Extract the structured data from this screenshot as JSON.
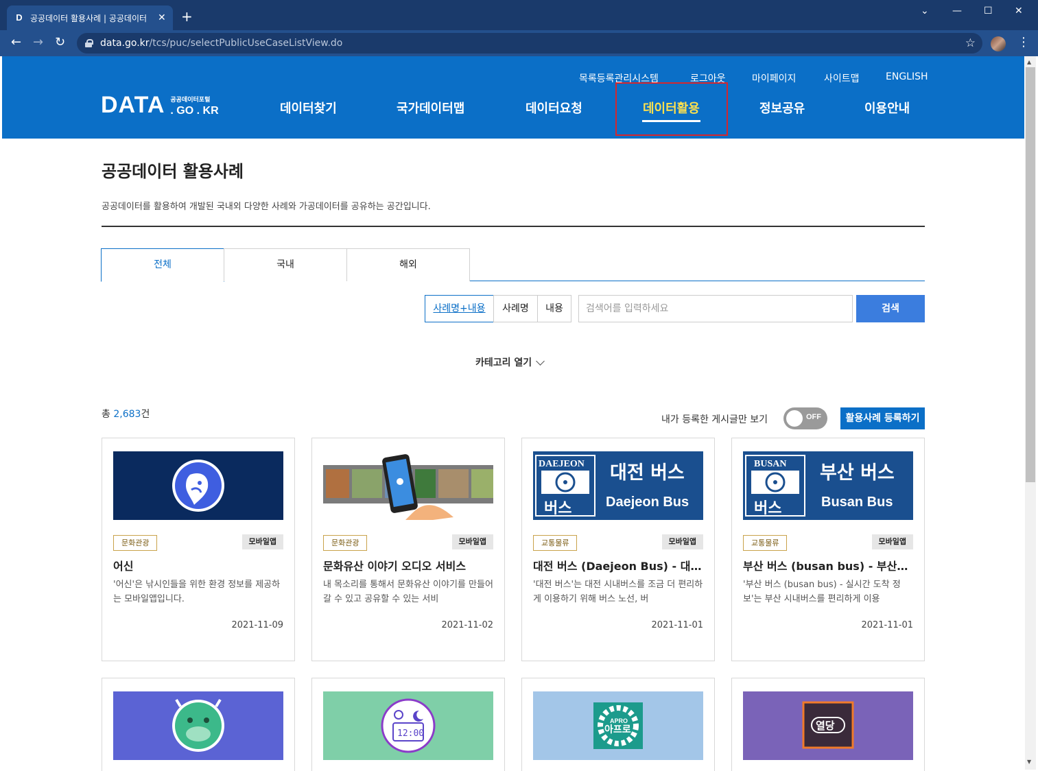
{
  "browser": {
    "tab_title": "공공데이터 활용사례 | 공공데이터",
    "url_host": "data.go.kr",
    "url_path": "/tcs/puc/selectPublicUseCaseListView.do"
  },
  "header": {
    "util_links": [
      "목록등록관리시스템",
      "로그아웃",
      "마이페이지",
      "사이트맵",
      "ENGLISH"
    ],
    "logo_main": "DATA",
    "logo_small": "공공데이터포털",
    "logo_domain": ". GO . KR",
    "gnb": [
      "데이터찾기",
      "국가데이터맵",
      "데이터요청",
      "데이터활용",
      "정보공유",
      "이용안내"
    ],
    "active_gnb": "데이터활용"
  },
  "page": {
    "title": "공공데이터 활용사례",
    "description": "공공데이터를 활용하여 개발된 국내외 다양한 사례와 가공데이터를 공유하는 공간입니다.",
    "tabs": [
      "전체",
      "국내",
      "해외"
    ],
    "active_tab": "전체"
  },
  "search": {
    "filters": [
      "사례명+내용",
      "사례명",
      "내용"
    ],
    "active_filter": "사례명+내용",
    "placeholder": "검색어를 입력하세요",
    "button": "검색"
  },
  "category_toggle": "카테고리 열기",
  "list_meta": {
    "total_prefix": "총 ",
    "total_count": "2,683",
    "total_suffix": "건",
    "mine_label": "내가 등록한 게시글만 보기",
    "toggle_state": "OFF",
    "register_button": "활용사례 등록하기"
  },
  "cards": [
    {
      "category": "문화관광",
      "type": "모바일앱",
      "title": "어신",
      "desc": "'어신'은 낚시인들을 위한 환경 정보를 제공하는 모바일앱입니다.",
      "date": "2021-11-09",
      "thumb_bg": "#0a2a5e",
      "thumb_icon": "fish-logo-icon"
    },
    {
      "category": "문화관광",
      "type": "모바일앱",
      "title": "문화유산 이야기 오디오 서비스",
      "desc": "내 목소리를 통해서 문화유산 이야기를 만들어갈 수 있고 공유할 수 있는 서비",
      "date": "2021-11-02",
      "thumb_bg": "#ffffff",
      "thumb_icon": "heritage-phone-icon"
    },
    {
      "category": "교통물류",
      "type": "모바일앱",
      "title": "대전 버스 (Daejeon Bus) - 대전광역시 버스 도착 정보",
      "desc": "'대전 버스'는 대전 시내버스를 조금 더 편리하게 이용하기 위해 버스 노선, 버",
      "date": "2021-11-01",
      "thumb_bg": "#1a4f8f",
      "thumb_icon": "daejeon-bus-logo",
      "thumb_en": "DAEJEON",
      "thumb_ko": "대전 버스",
      "thumb_sub": "Daejeon Bus",
      "thumb_small": "버스"
    },
    {
      "category": "교통물류",
      "type": "모바일앱",
      "title": "부산 버스 (busan bus) - 부산광역시 버스 도착 정보",
      "desc": "'부산 버스 (busan bus) - 실시간 도착 정보'는 부산 시내버스를 편리하게 이용",
      "date": "2021-11-01",
      "thumb_bg": "#1a4f8f",
      "thumb_icon": "busan-bus-logo",
      "thumb_en": "BUSAN",
      "thumb_ko": "부산 버스",
      "thumb_sub": "Busan Bus",
      "thumb_small": "버스"
    }
  ],
  "cards_row2": [
    {
      "thumb_bg": "#5b63d4",
      "thumb_icon": "cow-face-icon"
    },
    {
      "thumb_bg": "#7fcfa8",
      "thumb_icon": "clock-sun-moon-icon",
      "thumb_text": "12:00"
    },
    {
      "thumb_bg": "#a3c6e8",
      "thumb_icon": "apro-gear-icon",
      "thumb_text": "APRO",
      "thumb_text2": "아프로"
    },
    {
      "thumb_bg": "#7a63b8",
      "thumb_icon": "yeoldang-logo-icon",
      "thumb_text": "열당"
    }
  ],
  "colors": {
    "brand_blue": "#0b6fc7",
    "active_gnb": "#ffe14d",
    "search_button": "#3b7dde",
    "highlight_border": "#d6262c"
  }
}
